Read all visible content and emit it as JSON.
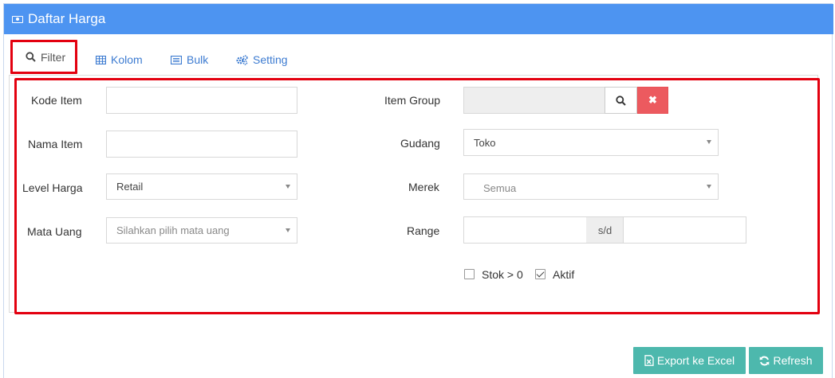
{
  "header": {
    "title": "Daftar Harga",
    "icon": "money-icon"
  },
  "tabs": [
    {
      "label": "Filter",
      "icon": "search-icon"
    },
    {
      "label": "Kolom",
      "icon": "table-icon"
    },
    {
      "label": "Bulk",
      "icon": "list-icon"
    },
    {
      "label": "Setting",
      "icon": "gears-icon"
    }
  ],
  "filter": {
    "kode_item": {
      "label": "Kode Item",
      "value": ""
    },
    "nama_item": {
      "label": "Nama Item",
      "value": ""
    },
    "level_harga": {
      "label": "Level Harga",
      "value": "Retail"
    },
    "mata_uang": {
      "label": "Mata Uang",
      "placeholder": "Silahkan pilih mata uang"
    },
    "item_group": {
      "label": "Item Group",
      "value": "",
      "clear_symbol": "✖"
    },
    "gudang": {
      "label": "Gudang",
      "value": "Toko"
    },
    "merek": {
      "label": "Merek",
      "value": "Semua"
    },
    "range": {
      "label": "Range",
      "separator": "s/d",
      "from": "",
      "to": ""
    },
    "stok": {
      "label": "Stok > 0",
      "checked": false
    },
    "aktif": {
      "label": "Aktif",
      "checked": true
    }
  },
  "actions": {
    "export_label": "Export ke Excel",
    "refresh_label": "Refresh"
  },
  "colors": {
    "header": "#4d94f1",
    "accent_link": "#3c7bd1",
    "annotation_red": "#e3000f",
    "clear_button": "#ec5a5f",
    "action_button": "#4db8ad"
  }
}
